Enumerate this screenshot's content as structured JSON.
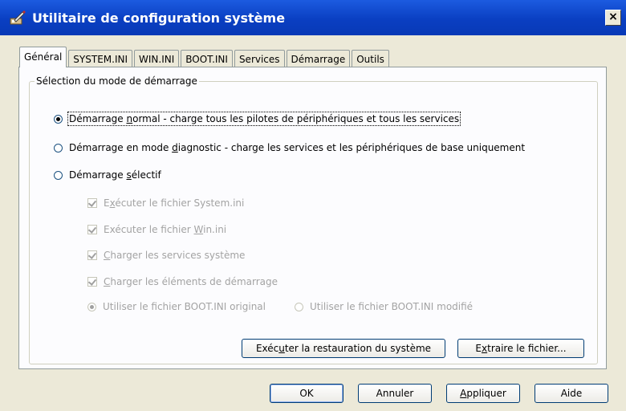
{
  "window": {
    "title": "Utilitaire de configuration système",
    "icon": "config-utility-icon",
    "close_glyph": "×"
  },
  "tabs": [
    {
      "label": "Général",
      "active": true
    },
    {
      "label": "SYSTEM.INI",
      "active": false
    },
    {
      "label": "WIN.INI",
      "active": false
    },
    {
      "label": "BOOT.INI",
      "active": false
    },
    {
      "label": "Services",
      "active": false
    },
    {
      "label": "Démarrage",
      "active": false
    },
    {
      "label": "Outils",
      "active": false
    }
  ],
  "general": {
    "group_label": "Sélection du mode de démarrage",
    "radios": {
      "normal": {
        "pre": "Démarrage ",
        "ul": "n",
        "post": "ormal - charge tous les pilotes de périphériques et tous les services",
        "checked": true
      },
      "diagnostic": {
        "pre": "Démarrage en mode ",
        "ul": "d",
        "post": "iagnostic - charge les services et les périphériques de base uniquement",
        "checked": false
      },
      "selective": {
        "pre": "Démarrage ",
        "ul": "s",
        "post": "électif",
        "checked": false
      }
    },
    "selective_options": {
      "system_ini": {
        "pre": "E",
        "ul": "x",
        "post": "écuter le fichier System.ini",
        "checked": true
      },
      "win_ini": {
        "pre": "Exécuter le fichier ",
        "ul": "W",
        "post": "in.ini",
        "checked": true
      },
      "services": {
        "pre": "",
        "ul": "C",
        "post": "harger les services système",
        "checked": true
      },
      "startup": {
        "pre": "",
        "ul": "C",
        "post": "harger les éléments de démarrage",
        "checked": true
      },
      "boot_original": {
        "label": "Utiliser le fichier BOOT.INI original",
        "checked": true
      },
      "boot_modified": {
        "label": "Utiliser le fichier BOOT.INI modifié",
        "checked": false
      }
    },
    "buttons": {
      "restore": {
        "pre": "Exéc",
        "ul": "u",
        "post": "ter la restauration du système"
      },
      "extract": {
        "pre": "E",
        "ul": "x",
        "post": "traire le fichier..."
      }
    }
  },
  "footer": {
    "ok": "OK",
    "cancel": "Annuler",
    "apply": {
      "pre": "",
      "ul": "A",
      "post": "ppliquer"
    },
    "help": "Aide"
  },
  "colors": {
    "title_bar": "#0a3fc2",
    "dialog_bg": "#ece9d8",
    "panel_bg": "#fcfcfe",
    "disabled_text": "#a3a3a3"
  }
}
